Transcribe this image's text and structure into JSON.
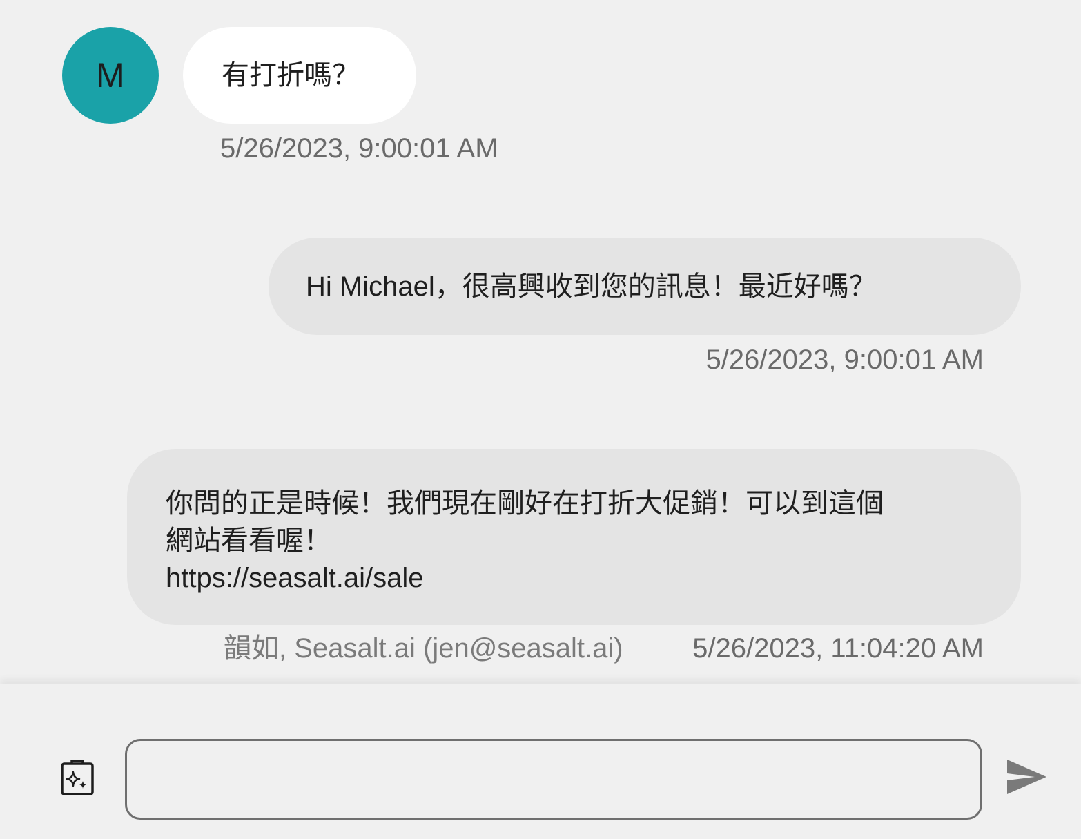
{
  "contact": {
    "avatar_initial": "M",
    "avatar_color": "#1aa2a8"
  },
  "messages": [
    {
      "direction": "incoming",
      "text": "有打折嗎？",
      "timestamp": "5/26/2023, 9:00:01 AM"
    },
    {
      "direction": "outgoing",
      "text": "Hi Michael，很高興收到您的訊息！最近好嗎？",
      "timestamp": "5/26/2023, 9:00:01 AM"
    },
    {
      "direction": "outgoing",
      "lines": [
        "你問的正是時候！我們現在剛好在打折大促銷！可以到這個",
        "網站看看喔！",
        "https://seasalt.ai/sale"
      ],
      "sender": "韻如, Seasalt.ai (jen@seasalt.ai)",
      "timestamp": "5/26/2023, 11:04:20 AM"
    }
  ],
  "composer": {
    "input_value": "",
    "ai_icon": "ai-sparkle-clipboard-icon",
    "send_icon": "send-icon"
  },
  "colors": {
    "background": "#f0f0f0",
    "incoming_bubble": "#ffffff",
    "outgoing_bubble": "#e4e4e4",
    "timestamp_text": "#6a6a6a",
    "send_icon": "#7a7a7a"
  }
}
